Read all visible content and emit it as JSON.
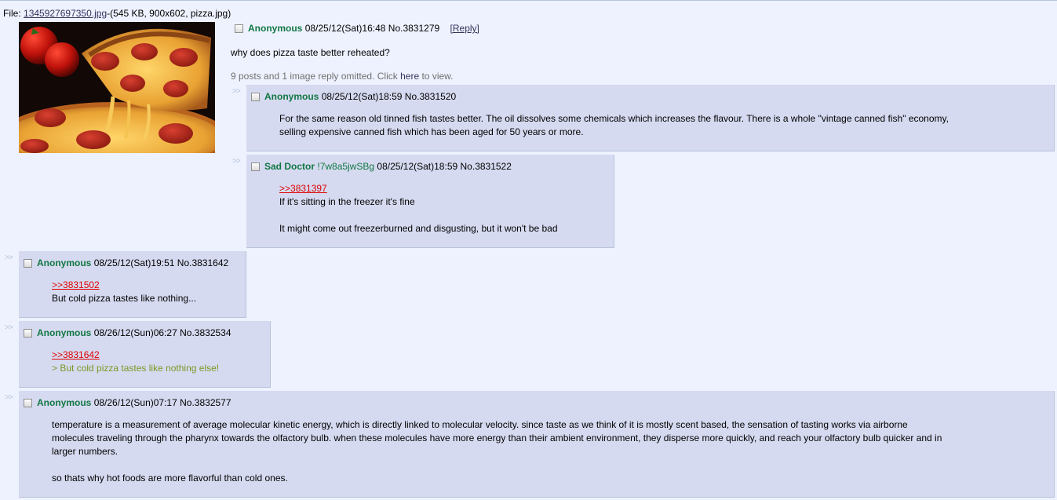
{
  "op": {
    "file_label": "File: ",
    "file_name": "1345927697350.jpg",
    "file_meta": "-(545 KB, 900x602, pizza.jpg)",
    "thumbnail": "pizza photo: pepperoni pizza slice with melted cheese and tomatoes",
    "name": "Anonymous",
    "datetime": "08/25/12(Sat)16:48",
    "post_no": "No.3831279",
    "reply_link": "[Reply]",
    "comment": "why does pizza taste better reheated?",
    "omitted_text": "9 posts and 1 image reply omitted. Click ",
    "omitted_link": "here",
    "omitted_suffix": " to view."
  },
  "arrows": ">>",
  "replies": [
    {
      "name": "Anonymous",
      "datetime": "08/25/12(Sat)18:59",
      "post_no": "No.3831520",
      "lines": [
        "For the same reason old tinned fish tastes better. The oil dissolves some chemicals which increases the flavour. There is a whole \"vintage canned fish\" economy,",
        "selling expensive canned fish which has been aged for 50 years or more."
      ]
    },
    {
      "name": "Sad Doctor",
      "tripcode": "!7w8a5jwSBg",
      "datetime": "08/25/12(Sat)18:59",
      "post_no": "No.3831522",
      "quotelink": ">>3831397",
      "line1": "If it's sitting in the freezer it's fine",
      "line2": "It might come out freezerburned and disgusting, but it won't be bad"
    },
    {
      "name": "Anonymous",
      "datetime": "08/25/12(Sat)19:51",
      "post_no": "No.3831642",
      "quotelink": ">>3831502",
      "line1": "But cold pizza tastes like nothing..."
    },
    {
      "name": "Anonymous",
      "datetime": "08/26/12(Sun)06:27",
      "post_no": "No.3832534",
      "quotelink": ">>3831642",
      "greentext": "> But cold pizza tastes like nothing else!"
    },
    {
      "name": "Anonymous",
      "datetime": "08/26/12(Sun)07:17",
      "post_no": "No.3832577",
      "lines": [
        "temperature is a measurement of average molecular kinetic energy, which is directly linked to molecular velocity. since taste as we think of it is mostly scent based, the sensation of tasting works via airborne",
        "molecules traveling through the pharynx towards the olfactory bulb. when these molecules have more energy than their ambient environment, they disperse more quickly, and reach your olfactory bulb quicker and in",
        "larger numbers."
      ],
      "line_last": "so thats why hot foods are more flavorful than cold ones."
    }
  ],
  "colors": {
    "background": "#eef2ff",
    "reply_bg": "#d6daf0",
    "name_green": "#117743",
    "quotelink_red": "#dd0000",
    "greentext": "#789922",
    "omitted_gray": "#707070"
  }
}
